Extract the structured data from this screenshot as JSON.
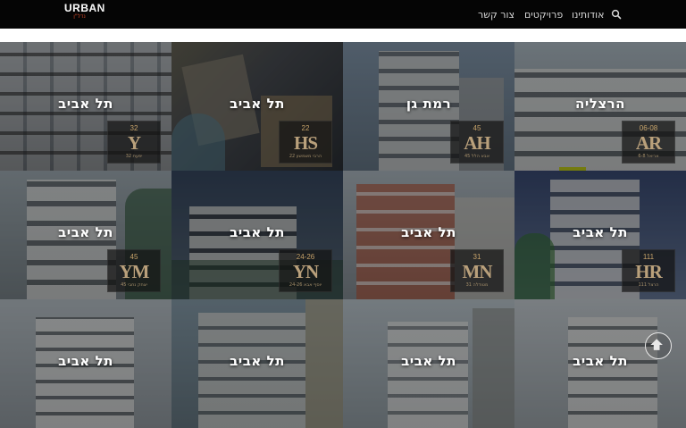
{
  "header": {
    "logo": {
      "title": "URBAN",
      "subtitle": "נדל\"ן"
    },
    "nav": {
      "contact": "צור קשר",
      "projects": "פרויקטים",
      "about": "אודותינו"
    }
  },
  "projects": [
    {
      "city": "תל אביב",
      "code": "Y",
      "number": "32",
      "street": "יפעת 32"
    },
    {
      "city": "תל אביב",
      "code": "HS",
      "number": "22",
      "street": "הרבי משמשון 22"
    },
    {
      "city": "רמת גן",
      "code": "AH",
      "number": "45",
      "street": "אבא הלל 45"
    },
    {
      "city": "הרצליה",
      "code": "AR",
      "number": "06-08",
      "street": "אריאל 6-8"
    },
    {
      "city": "תל אביב",
      "code": "YM",
      "number": "45",
      "street": "יצחק נחבי 45"
    },
    {
      "city": "תל אביב",
      "code": "YN",
      "number": "24-26",
      "street": "יוסף אבא 24-26"
    },
    {
      "city": "תל אביב",
      "code": "MN",
      "number": "31",
      "street": "מטודלה 31"
    },
    {
      "city": "תל אביב",
      "code": "HR",
      "number": "111",
      "street": "הרצל 111"
    },
    {
      "city": "תל אביב",
      "code": "",
      "number": "",
      "street": ""
    },
    {
      "city": "תל אביב",
      "code": "",
      "number": "",
      "street": ""
    },
    {
      "city": "תל אביב",
      "code": "",
      "number": "",
      "street": ""
    },
    {
      "city": "תל אביב",
      "code": "",
      "number": "",
      "street": ""
    }
  ],
  "colors": {
    "topbar": "#050505",
    "badge_text": "#b9a07b",
    "logo_accent": "#d44a2a"
  },
  "icons": {
    "search": "search-icon",
    "scroll_top": "arrow-up-icon"
  }
}
